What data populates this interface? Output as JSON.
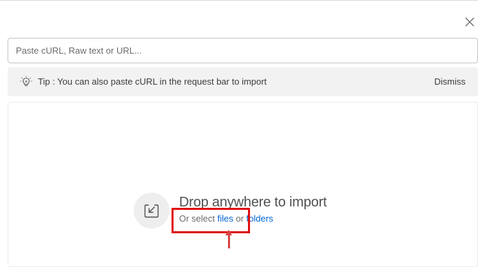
{
  "dialog": {
    "close_icon": "close-icon"
  },
  "import": {
    "input_placeholder": "Paste cURL, Raw text or URL...",
    "input_value": ""
  },
  "tip": {
    "icon": "lightbulb-icon",
    "text": "Tip : You can also paste cURL in the request bar to import",
    "dismiss_label": "Dismiss"
  },
  "drop_zone": {
    "icon": "import-icon",
    "title": "Drop anywhere to import",
    "sub_prefix": "Or select ",
    "files_link": "files",
    "sub_middle": " or ",
    "folders_link": "folders"
  },
  "annotation": {
    "highlight_color": "#e01010",
    "arrow_color": "#d64545"
  },
  "colors": {
    "link": "#0265d2",
    "tip_background": "#f2f2f2"
  }
}
